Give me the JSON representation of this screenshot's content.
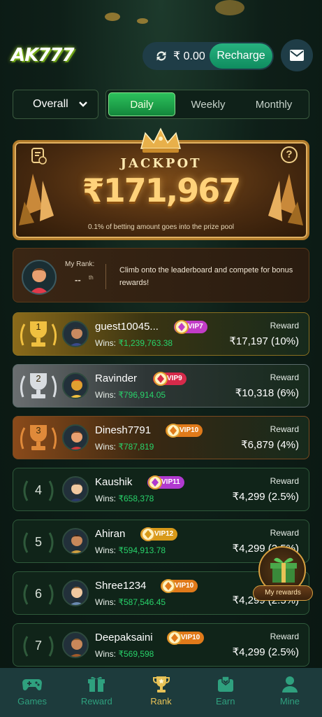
{
  "header": {
    "logo_text": "AK777",
    "balance": "₹ 0.00",
    "recharge_label": "Recharge"
  },
  "filters": {
    "scope_selected": "Overall",
    "tabs": [
      {
        "label": "Daily",
        "active": true
      },
      {
        "label": "Weekly",
        "active": false
      },
      {
        "label": "Monthly",
        "active": false
      }
    ]
  },
  "jackpot": {
    "title": "JACKPOT",
    "amount": "₹171,967",
    "note": "0.1% of betting amount goes into the prize pool",
    "help_label": "?"
  },
  "my_rank": {
    "label": "My Rank:",
    "value": "--",
    "suffix": "th",
    "message": "Climb onto the leaderboard and compete for bonus rewards!"
  },
  "leaderboard": {
    "reward_label": "Reward",
    "wins_prefix": "Wins: ",
    "rows": [
      {
        "rank": "1",
        "name": "guest10045...",
        "vip": "VIP7",
        "wins": "₹1,239,763.38",
        "reward": "₹17,197 (10%)"
      },
      {
        "rank": "2",
        "name": "Ravinder",
        "vip": "VIP9",
        "wins": "₹796,914.05",
        "reward": "₹10,318 (6%)"
      },
      {
        "rank": "3",
        "name": "Dinesh7791",
        "vip": "VIP10",
        "wins": "₹787,819",
        "reward": "₹6,879 (4%)"
      },
      {
        "rank": "4",
        "name": "Kaushik",
        "vip": "VIP11",
        "wins": "₹658,378",
        "reward": "₹4,299 (2.5%)"
      },
      {
        "rank": "5",
        "name": "Ahiran",
        "vip": "VIP12",
        "wins": "₹594,913.78",
        "reward": "₹4,299 (2.5%)"
      },
      {
        "rank": "6",
        "name": "Shree1234",
        "vip": "VIP10",
        "wins": "₹587,546.45",
        "reward": "₹4,299 (2.5%)"
      },
      {
        "rank": "7",
        "name": "Deepaksaini",
        "vip": "VIP10",
        "wins": "₹569,598",
        "reward": "₹4,299 (2.5%)"
      }
    ]
  },
  "my_rewards_label": "My rewards",
  "nav": [
    {
      "label": "Games",
      "icon": "gamepad-icon",
      "active": false
    },
    {
      "label": "Reward",
      "icon": "gift-icon",
      "active": false
    },
    {
      "label": "Rank",
      "icon": "trophy-icon",
      "active": true
    },
    {
      "label": "Earn",
      "icon": "earn-icon",
      "active": false
    },
    {
      "label": "Mine",
      "icon": "user-icon",
      "active": false
    }
  ],
  "colors": {
    "accent_green": "#28d26a",
    "active_nav": "#e8c256",
    "jackpot_gold": "#ffd27a",
    "vip7": "#c23cc8",
    "vip9": "#d62a4a",
    "vip10": "#e07a1a",
    "vip11": "#b03ad0",
    "vip12": "#d89a1a"
  }
}
